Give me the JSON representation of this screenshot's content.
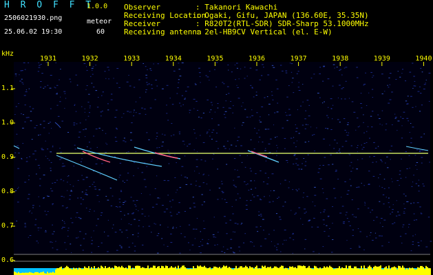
{
  "header": {
    "app_title": "H R O F F T",
    "app_version": "1.0.0",
    "file_name": "2506021930.png",
    "timestamp": "25.06.02 19:30",
    "mode_label": "meteor",
    "mode_value": "60",
    "observer_label": "Observer",
    "observer_value": ": Takanori Kawachi",
    "location_label": "Receiving Location",
    "location_value": ": Ogaki, Gifu, JAPAN (136.60E, 35.35N)",
    "receiver_label": "Receiver",
    "receiver_value": ": R820T2(RTL-SDR) SDR-Sharp 53.1000MHz",
    "antenna_label": "Receiving antenna",
    "antenna_value": ": 2el-HB9CV Vertical (el. E-W)"
  },
  "plot": {
    "y_unit": "kHz",
    "x_ticks": [
      "1931",
      "1932",
      "1933",
      "1934",
      "1935",
      "1936",
      "1937",
      "1938",
      "1939",
      "1940"
    ],
    "y_ticks": [
      "1.1",
      "1.0",
      "0.9",
      "0.8",
      "0.7",
      "0.6"
    ],
    "colors": {
      "background": "#000000",
      "noise": "#1a2a8a",
      "carrier": "#c8e060",
      "echo": "#60d0ff",
      "echo_hot": "#ff6080",
      "bar": "#ffff00",
      "bar_base": "#00c0ff",
      "grid": "#ffff00"
    }
  }
}
